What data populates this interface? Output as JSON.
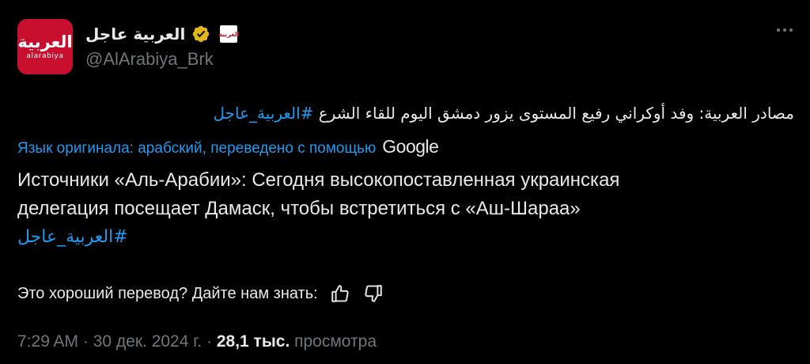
{
  "author": {
    "display_name": "العربية عاجل",
    "handle": "@AlArabiya_Brk",
    "avatar_logo_ar": "العربية",
    "avatar_logo_lat": "alarabiya",
    "affiliate_badge_text": "العربية",
    "verified_color": "#e2b719",
    "avatar_color": "#c8102e"
  },
  "tweet": {
    "original_text": "مصادر العربية: وفد أوكراني رفيع المستوى يزور دمشق اليوم للقاء الشرع ",
    "original_hashtag": "#العربية_عاجل",
    "translated_label": "Язык оригинала: арабский, переведено с помощью",
    "translator_logo": "Google",
    "translation_line1": "Источники «Аль-Арабии»: Сегодня высокопоставленная украинская",
    "translation_line2": "делегация посещает Дамаск, чтобы встретиться с «Аш-Шараа»",
    "translation_hashtag": "#العربية_عاجل"
  },
  "feedback": {
    "question": "Это хороший перевод? Дайте нам знать:",
    "thumbs_up_icon": "thumbs-up-icon",
    "thumbs_down_icon": "thumbs-down-icon"
  },
  "meta": {
    "time_and_date": "7:29 AM · 30 дек. 2024 г. · ",
    "views_count": "28,1 тыс.",
    "views_label": " просмотра"
  },
  "colors": {
    "background": "#000000",
    "text": "#e7e9ea",
    "muted": "#71767b",
    "link": "#1d9bf0"
  }
}
